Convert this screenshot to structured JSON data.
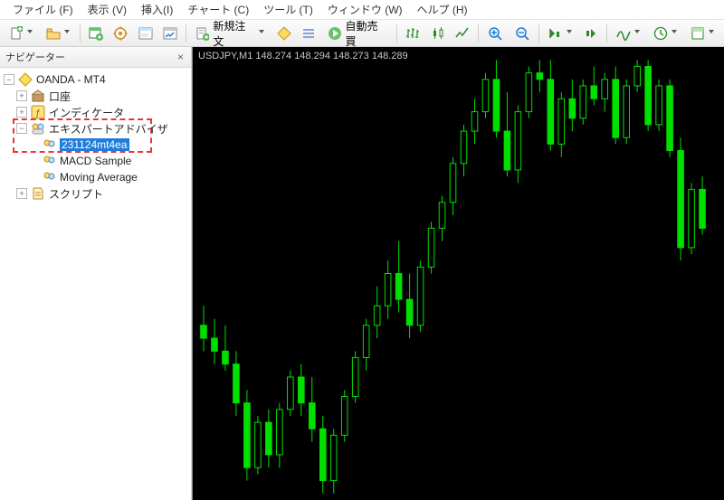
{
  "menu": {
    "file": "ファイル (F)",
    "view": "表示 (V)",
    "insert": "挿入(I)",
    "chart": "チャート (C)",
    "tools": "ツール (T)",
    "window": "ウィンドウ (W)",
    "help": "ヘルプ (H)"
  },
  "toolbar": {
    "new_order": "新規注文",
    "auto_trade": "自動売買"
  },
  "sidebar": {
    "title": "ナビゲーター",
    "account_root": "OANDA - MT4",
    "accounts": "口座",
    "indicators": "インディケータ",
    "experts": "エキスパートアドバイザ",
    "expert_items": [
      "231124mt4ea",
      "MACD Sample",
      "Moving Average"
    ],
    "scripts": "スクリプト"
  },
  "chart": {
    "title": "USDJPY,M1  148.274 148.294 148.273 148.289"
  },
  "chart_data": {
    "type": "candlestick",
    "symbol": "USDJPY",
    "timeframe": "M1",
    "ohlc_last": {
      "open": 148.274,
      "high": 148.294,
      "low": 148.273,
      "close": 148.289
    },
    "approx_visible_range": {
      "low": 147.65,
      "high": 148.35
    },
    "candles": [
      {
        "o": 147.92,
        "h": 147.95,
        "l": 147.88,
        "c": 147.9,
        "up": false
      },
      {
        "o": 147.9,
        "h": 147.93,
        "l": 147.86,
        "c": 147.88,
        "up": false
      },
      {
        "o": 147.88,
        "h": 147.92,
        "l": 147.85,
        "c": 147.86,
        "up": false
      },
      {
        "o": 147.86,
        "h": 147.88,
        "l": 147.78,
        "c": 147.8,
        "up": false
      },
      {
        "o": 147.8,
        "h": 147.82,
        "l": 147.68,
        "c": 147.7,
        "up": false
      },
      {
        "o": 147.7,
        "h": 147.78,
        "l": 147.69,
        "c": 147.77,
        "up": true
      },
      {
        "o": 147.77,
        "h": 147.79,
        "l": 147.7,
        "c": 147.72,
        "up": false
      },
      {
        "o": 147.72,
        "h": 147.8,
        "l": 147.7,
        "c": 147.79,
        "up": true
      },
      {
        "o": 147.79,
        "h": 147.85,
        "l": 147.78,
        "c": 147.84,
        "up": true
      },
      {
        "o": 147.84,
        "h": 147.86,
        "l": 147.78,
        "c": 147.8,
        "up": false
      },
      {
        "o": 147.8,
        "h": 147.84,
        "l": 147.74,
        "c": 147.76,
        "up": false
      },
      {
        "o": 147.76,
        "h": 147.78,
        "l": 147.66,
        "c": 147.68,
        "up": false
      },
      {
        "o": 147.68,
        "h": 147.76,
        "l": 147.66,
        "c": 147.75,
        "up": true
      },
      {
        "o": 147.75,
        "h": 147.82,
        "l": 147.74,
        "c": 147.81,
        "up": true
      },
      {
        "o": 147.81,
        "h": 147.88,
        "l": 147.8,
        "c": 147.87,
        "up": true
      },
      {
        "o": 147.87,
        "h": 147.93,
        "l": 147.85,
        "c": 147.92,
        "up": true
      },
      {
        "o": 147.92,
        "h": 147.98,
        "l": 147.9,
        "c": 147.95,
        "up": true
      },
      {
        "o": 147.95,
        "h": 148.02,
        "l": 147.93,
        "c": 148.0,
        "up": true
      },
      {
        "o": 148.0,
        "h": 148.05,
        "l": 147.94,
        "c": 147.96,
        "up": false
      },
      {
        "o": 147.96,
        "h": 148.0,
        "l": 147.9,
        "c": 147.92,
        "up": false
      },
      {
        "o": 147.92,
        "h": 148.02,
        "l": 147.91,
        "c": 148.01,
        "up": true
      },
      {
        "o": 148.01,
        "h": 148.08,
        "l": 148.0,
        "c": 148.07,
        "up": true
      },
      {
        "o": 148.07,
        "h": 148.12,
        "l": 148.05,
        "c": 148.11,
        "up": true
      },
      {
        "o": 148.11,
        "h": 148.18,
        "l": 148.09,
        "c": 148.17,
        "up": true
      },
      {
        "o": 148.17,
        "h": 148.23,
        "l": 148.15,
        "c": 148.22,
        "up": true
      },
      {
        "o": 148.22,
        "h": 148.27,
        "l": 148.2,
        "c": 148.25,
        "up": true
      },
      {
        "o": 148.25,
        "h": 148.31,
        "l": 148.24,
        "c": 148.3,
        "up": true
      },
      {
        "o": 148.3,
        "h": 148.33,
        "l": 148.21,
        "c": 148.22,
        "up": false
      },
      {
        "o": 148.22,
        "h": 148.28,
        "l": 148.15,
        "c": 148.16,
        "up": false
      },
      {
        "o": 148.16,
        "h": 148.26,
        "l": 148.14,
        "c": 148.25,
        "up": true
      },
      {
        "o": 148.25,
        "h": 148.32,
        "l": 148.24,
        "c": 148.31,
        "up": true
      },
      {
        "o": 148.31,
        "h": 148.33,
        "l": 148.28,
        "c": 148.3,
        "up": false
      },
      {
        "o": 148.3,
        "h": 148.33,
        "l": 148.19,
        "c": 148.2,
        "up": false
      },
      {
        "o": 148.2,
        "h": 148.28,
        "l": 148.18,
        "c": 148.27,
        "up": true
      },
      {
        "o": 148.27,
        "h": 148.3,
        "l": 148.22,
        "c": 148.24,
        "up": false
      },
      {
        "o": 148.24,
        "h": 148.3,
        "l": 148.23,
        "c": 148.29,
        "up": true
      },
      {
        "o": 148.29,
        "h": 148.32,
        "l": 148.26,
        "c": 148.27,
        "up": false
      },
      {
        "o": 148.27,
        "h": 148.31,
        "l": 148.25,
        "c": 148.3,
        "up": true
      },
      {
        "o": 148.3,
        "h": 148.32,
        "l": 148.2,
        "c": 148.21,
        "up": false
      },
      {
        "o": 148.21,
        "h": 148.3,
        "l": 148.2,
        "c": 148.29,
        "up": true
      },
      {
        "o": 148.29,
        "h": 148.33,
        "l": 148.28,
        "c": 148.32,
        "up": true
      },
      {
        "o": 148.32,
        "h": 148.33,
        "l": 148.22,
        "c": 148.23,
        "up": false
      },
      {
        "o": 148.23,
        "h": 148.3,
        "l": 148.22,
        "c": 148.29,
        "up": true
      },
      {
        "o": 148.29,
        "h": 148.3,
        "l": 148.18,
        "c": 148.19,
        "up": false
      },
      {
        "o": 148.19,
        "h": 148.21,
        "l": 148.02,
        "c": 148.04,
        "up": false
      },
      {
        "o": 148.04,
        "h": 148.14,
        "l": 148.03,
        "c": 148.13,
        "up": true
      },
      {
        "o": 148.13,
        "h": 148.15,
        "l": 148.06,
        "c": 148.07,
        "up": false
      }
    ]
  }
}
